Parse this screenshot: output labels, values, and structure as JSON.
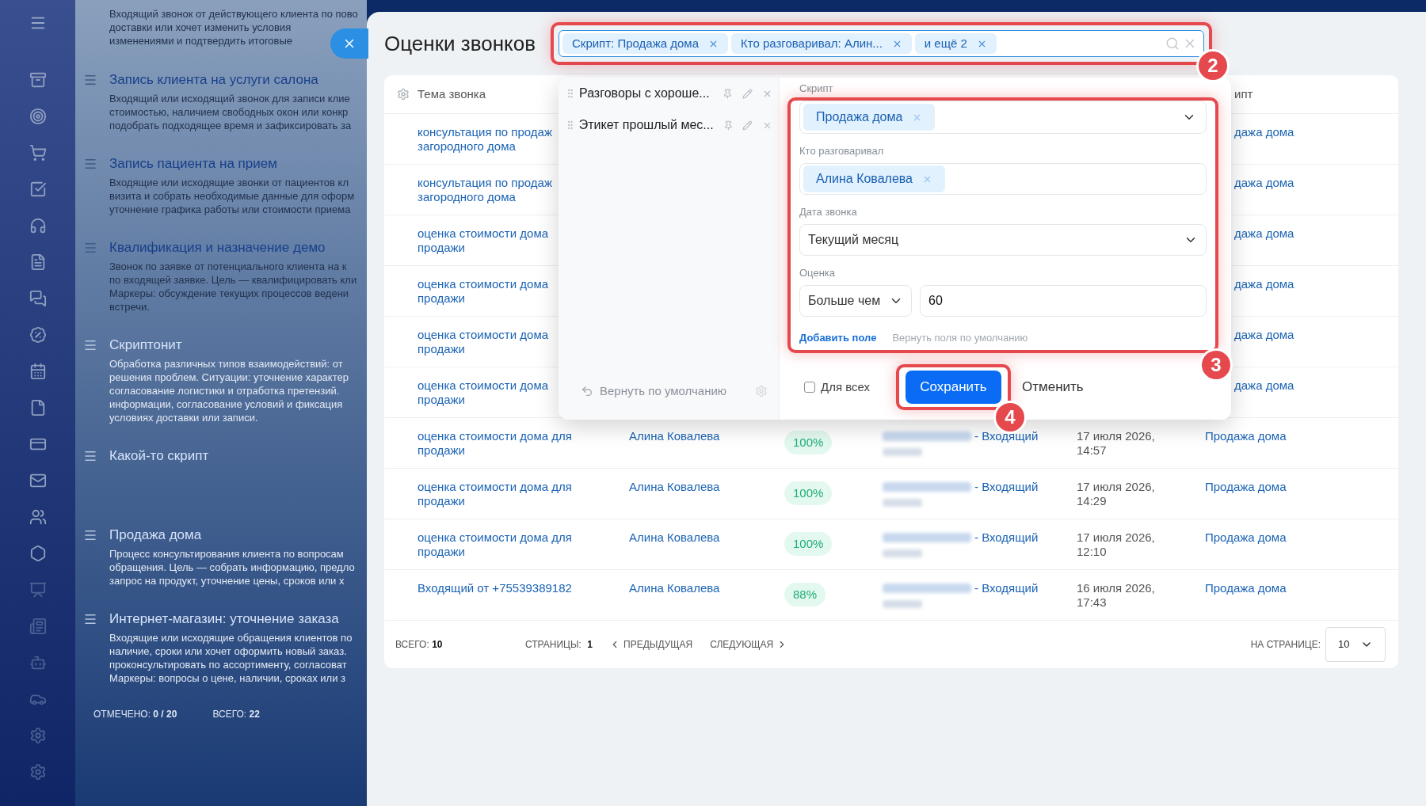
{
  "background_list": {
    "items": [
      {
        "description_lines": [
          "Входящий звонок от действующего клиента по пово",
          "доставки или хочет изменить условия",
          "изменениями и подтвердить итоговые"
        ]
      },
      {
        "title": "Запись клиента на услуги салона",
        "description_lines": [
          "Входящий или исходящий звонок для записи клие",
          "стоимостью, наличием свободных окон или конкр",
          "подобрать подходящее время и зафиксировать за"
        ]
      },
      {
        "title": "Запись пациента на прием",
        "description_lines": [
          "Входящие или исходящие звонки от пациентов кл",
          "визита и собрать необходимые данные для оформ",
          "уточнение графика работы или стоимости приема"
        ]
      },
      {
        "title": "Квалификация и назначение демо",
        "description_lines": [
          "Звонок по заявке от потенциального клиента на к",
          "по входящей заявке. Цель — квалифицировать кли",
          "Маркеры: обсуждение текущих процессов ведени",
          "встречи."
        ]
      },
      {
        "title": "Скриптонит",
        "description_lines": [
          "Обработка различных типов взаимодействий: от",
          "решения проблем. Ситуации: уточнение характер",
          "согласование логистики и отработка претензий.",
          "информации, согласование условий и фиксация",
          "условиях доставки или записи."
        ]
      },
      {
        "title": "Какой-то скрипт"
      },
      {
        "title": "Продажа дома",
        "description_lines": [
          "Процесс консультирования клиента по вопросам",
          "обращения. Цель — собрать информацию, предло",
          "запрос на продукт, уточнение цены, сроков или х"
        ]
      },
      {
        "title": "Интернет-магазин: уточнение заказа",
        "description_lines": [
          "Входящие или исходящие обращения клиентов по",
          "наличие, сроки или хочет оформить новый заказ.",
          "проконсультировать по ассортименту, согласоват",
          "Маркеры: вопросы о цене, наличии, сроках или з"
        ]
      }
    ],
    "footer": [
      {
        "label": "ОТМЕЧЕНО:",
        "value": "0 / 20"
      },
      {
        "label": "ВСЕГО:",
        "value": "22"
      }
    ]
  },
  "panel": {
    "title": "Оценки звонков"
  },
  "filter_bar": {
    "chips": [
      {
        "label": "Скрипт: Продажа дома"
      },
      {
        "label": "Кто разговаривал: Алин..."
      },
      {
        "label": "и ещё 2"
      }
    ],
    "annotation": "2"
  },
  "filter_popup": {
    "presets": [
      {
        "label": "Разговоры с хороше..."
      },
      {
        "label": "Этикет прошлый мес..."
      }
    ],
    "reset_label": "Вернуть по умолчанию",
    "fields": [
      {
        "kind": "tag-select",
        "label": "Скрипт",
        "tags": [
          "Продажа дома"
        ]
      },
      {
        "kind": "tags",
        "label": "Кто разговаривал",
        "tags": [
          "Алина Ковалева"
        ]
      },
      {
        "kind": "select",
        "label": "Дата звонка",
        "value": "Текущий месяц"
      },
      {
        "kind": "compare",
        "label": "Оценка",
        "operator": "Больше чем",
        "value": "60"
      }
    ],
    "add_field": "Добавить поле",
    "reset_fields": "Вернуть поля по умолчанию",
    "for_all": {
      "label": "Для всех",
      "checked": false
    },
    "save": "Сохранить",
    "cancel": "Отменить",
    "fields_annotation": "3",
    "save_annotation": "4"
  },
  "table": {
    "columns": [
      "Тема звонка",
      "ипт"
    ],
    "rows": [
      {
        "kind": "partial",
        "topic_lines": [
          "консультация по продаж",
          "загородного дома"
        ],
        "script": "дажа дома"
      },
      {
        "kind": "partial",
        "topic_lines": [
          "консультация по продаж",
          "загородного дома"
        ],
        "script": "дажа дома"
      },
      {
        "kind": "partial",
        "topic_lines": [
          "оценка стоимости дома",
          "продажи"
        ],
        "script": "дажа дома"
      },
      {
        "kind": "partial",
        "topic_lines": [
          "оценка стоимости дома",
          "продажи"
        ],
        "script": "дажа дома"
      },
      {
        "kind": "partial",
        "topic_lines": [
          "оценка стоимости дома",
          "продажи"
        ],
        "script": "дажа дома"
      },
      {
        "kind": "partial",
        "topic_lines": [
          "оценка стоимости дома",
          "продажи"
        ],
        "script": "дажа дома"
      },
      {
        "kind": "full",
        "topic_lines": [
          "оценка стоимости дома для",
          "продажи"
        ],
        "person": "Алина Ковалева",
        "score": "100%",
        "call": "- Входящий",
        "date_lines": [
          "17 июля 2026,",
          "14:57"
        ],
        "script": "Продажа дома"
      },
      {
        "kind": "full",
        "topic_lines": [
          "оценка стоимости дома для",
          "продажи"
        ],
        "person": "Алина Ковалева",
        "score": "100%",
        "call": "- Входящий",
        "date_lines": [
          "17 июля 2026,",
          "14:29"
        ],
        "script": "Продажа дома"
      },
      {
        "kind": "full",
        "topic_lines": [
          "оценка стоимости дома для",
          "продажи"
        ],
        "person": "Алина Ковалева",
        "score": "100%",
        "call": "- Входящий",
        "date_lines": [
          "17 июля 2026,",
          "12:10"
        ],
        "script": "Продажа дома"
      },
      {
        "kind": "full",
        "topic_lines": [
          "Входящий от +75539389182"
        ],
        "person": "Алина Ковалева",
        "score": "88%",
        "call": "- Входящий",
        "date_lines": [
          "16 июля 2026,",
          "17:43"
        ],
        "script": "Продажа дома"
      }
    ],
    "footer": {
      "total_label": "ВСЕГО:",
      "total": "10",
      "pages_label": "СТРАНИЦЫ:",
      "page": "1",
      "prev": "ПРЕДЫДУЩАЯ",
      "next": "СЛЕДУЮЩАЯ",
      "per_page_label": "НА СТРАНИЦЕ:",
      "per_page": "10"
    }
  }
}
